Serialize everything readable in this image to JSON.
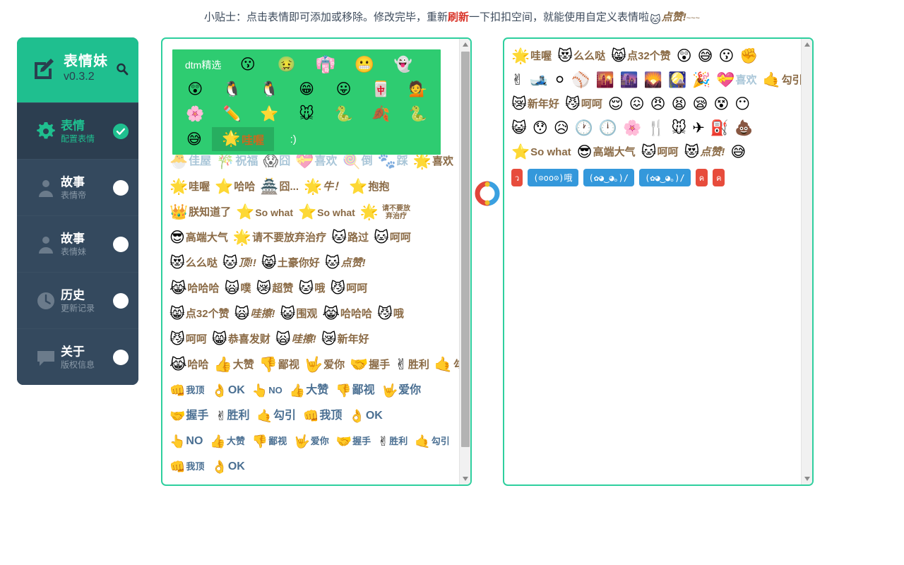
{
  "tip": {
    "before_hl": "小贴士：点击表情即可添加或移除。修改完毕，重新",
    "hl": "刷新",
    "after_hl": "一下扣扣空间，就能使用自定义表情啦",
    "emoji": "🐱",
    "zan": "点赞!",
    "tail": "~~~"
  },
  "sidebar": {
    "header": {
      "app_name": "表情妹",
      "version": "v0.3.2",
      "edit_icon": "edit-square-icon",
      "search_icon": "search-icon"
    },
    "items": [
      {
        "title": "表情",
        "subtitle": "配置表情",
        "icon": "gear-icon",
        "active": true,
        "toggle": "check-circle"
      },
      {
        "title": "故事",
        "subtitle": "表情帝",
        "icon": "user-icon",
        "active": false,
        "toggle": "dot"
      },
      {
        "title": "故事",
        "subtitle": "表情妹",
        "icon": "user-icon",
        "active": false,
        "toggle": "dot"
      },
      {
        "title": "历史",
        "subtitle": "更新记录",
        "icon": "clock-icon",
        "active": false,
        "toggle": "dot"
      },
      {
        "title": "关于",
        "subtitle": "版权信息",
        "icon": "comment-icon",
        "active": false,
        "toggle": "dot"
      }
    ]
  },
  "featured": {
    "label": "dtm精选",
    "row1": [
      "😗",
      "🤢",
      "👘",
      "😬",
      "👻"
    ],
    "row2": [
      "😲",
      "🐧",
      "🐧",
      "😁",
      "😛",
      "🀄",
      "💁"
    ],
    "row3": [
      "🌸",
      "✏️",
      "⭐",
      "🐭",
      "🐍",
      "🍂",
      "🐍"
    ],
    "smile": "😅",
    "chip": {
      "glyph": "🌟",
      "word": "哇喔"
    },
    "semicolon": ":)"
  },
  "left_panel": {
    "rows": [
      {
        "style": "pale",
        "items": [
          {
            "g": "🐣",
            "w": "佳屋"
          },
          {
            "g": "🎋",
            "w": "祝福"
          },
          {
            "g": "😱",
            "w": "囧"
          },
          {
            "g": "💝",
            "w": "喜欢"
          },
          {
            "g": "🍭",
            "w": "倒"
          },
          {
            "g": "🐾",
            "w": "踩"
          },
          {
            "g": "🌟",
            "w": "喜欢",
            "warm": true
          }
        ]
      },
      {
        "style": "warm",
        "items": [
          {
            "g": "🌟",
            "w": "哇喔"
          },
          {
            "g": "⭐",
            "w": "哈哈"
          },
          {
            "g": "🏯",
            "w": "囧..."
          },
          {
            "g": "🌟",
            "w": "牛！",
            "ital": true
          },
          {
            "g": "⭐",
            "w": "抱抱"
          }
        ]
      },
      {
        "style": "warm",
        "items": [
          {
            "g": "👑",
            "w": "朕知道了"
          },
          {
            "g": "⭐",
            "w": "So what",
            "sw": true
          },
          {
            "g": "⭐",
            "w": "So what",
            "sw": true
          },
          {
            "g": "🌟",
            "w": "请不要放弃治疗",
            "two": true
          }
        ]
      },
      {
        "style": "warm",
        "items": [
          {
            "g": "😎",
            "w": "高端大气"
          },
          {
            "g": "🌟",
            "w": "请不要放弃治疗"
          },
          {
            "g": "🐱",
            "w": "路过"
          },
          {
            "g": "🐱",
            "w": "呵呵"
          }
        ]
      },
      {
        "style": "warm",
        "items": [
          {
            "g": "😻",
            "w": "么么哒"
          },
          {
            "g": "🐱",
            "w": "顶!!",
            "ital": true
          },
          {
            "g": "😸",
            "w": "土豪你好"
          },
          {
            "g": "🐱",
            "w": "点赞!",
            "ital": true
          }
        ]
      },
      {
        "style": "warm",
        "items": [
          {
            "g": "😹",
            "w": "哈哈哈"
          },
          {
            "g": "🙀",
            "w": "噗"
          },
          {
            "g": "😿",
            "w": "超赞"
          },
          {
            "g": "🐱",
            "w": "哦"
          },
          {
            "g": "😼",
            "w": "呵呵"
          }
        ]
      },
      {
        "style": "warm",
        "items": [
          {
            "g": "😸",
            "w": "点32个赞"
          },
          {
            "g": "🙀",
            "w": "哇擦!",
            "ital": true
          },
          {
            "g": "😺",
            "w": "围观"
          },
          {
            "g": "😹",
            "w": "哈哈哈"
          },
          {
            "g": "😼",
            "w": "哦"
          }
        ]
      },
      {
        "style": "warm",
        "items": [
          {
            "g": "😼",
            "w": "呵呵"
          },
          {
            "g": "😸",
            "w": "恭喜发财"
          },
          {
            "g": "🙀",
            "w": "哇擦!",
            "ital": true
          },
          {
            "g": "😿",
            "w": "新年好"
          }
        ]
      },
      {
        "style": "mixed",
        "items": [
          {
            "g": "😹",
            "w": "哈哈",
            "warm": true
          },
          {
            "g": "👍",
            "w": "大赞"
          },
          {
            "g": "👎",
            "w": "鄙视"
          },
          {
            "g": "🤟",
            "w": "爱你"
          },
          {
            "g": "🤝",
            "w": "握手"
          },
          {
            "g": "✌",
            "w": "胜利"
          },
          {
            "g": "🤙",
            "w": "勾引"
          }
        ]
      },
      {
        "style": "hands",
        "items": [
          {
            "g": "👊",
            "w": "我顶"
          },
          {
            "g": "👌",
            "w": "OK",
            "big": true
          },
          {
            "g": "👆",
            "w": "NO"
          },
          {
            "g": "👍",
            "w": "大赞",
            "big": true
          },
          {
            "g": "👎",
            "w": "鄙视",
            "big": true
          },
          {
            "g": "🤟",
            "w": "爱你",
            "big": true
          }
        ]
      },
      {
        "style": "hands",
        "items": [
          {
            "g": "🤝",
            "w": "握手",
            "big": true
          },
          {
            "g": "✌",
            "w": "胜利",
            "big": true
          },
          {
            "g": "🤙",
            "w": "勾引",
            "big": true
          },
          {
            "g": "👊",
            "w": "我顶",
            "big": true
          },
          {
            "g": "👌",
            "w": "OK",
            "big": true
          }
        ]
      },
      {
        "style": "hands",
        "items": [
          {
            "g": "👆",
            "w": "NO",
            "big": true
          },
          {
            "g": "👍",
            "w": "大赞"
          },
          {
            "g": "👎",
            "w": "鄙视"
          },
          {
            "g": "🤟",
            "w": "爱你"
          },
          {
            "g": "🤝",
            "w": "握手"
          },
          {
            "g": "✌",
            "w": "胜利"
          },
          {
            "g": "🤙",
            "w": "勾引"
          }
        ]
      },
      {
        "style": "hands",
        "items": [
          {
            "g": "👊",
            "w": "我顶"
          },
          {
            "g": "👌",
            "w": "OK",
            "big": true
          }
        ]
      }
    ]
  },
  "right_panel": {
    "rows": [
      {
        "items": [
          {
            "g": "🌟",
            "w": "哇喔"
          },
          {
            "g": "😻",
            "w": "么么哒"
          },
          {
            "g": "😸",
            "w": "点32个赞"
          },
          {
            "g": "😲"
          },
          {
            "g": "😅"
          },
          {
            "g": "😗"
          },
          {
            "g": "✊"
          }
        ]
      },
      {
        "items": [
          {
            "g": "✌"
          },
          {
            "g": "🎿"
          },
          {
            "g": "⚪"
          },
          {
            "g": "⚾"
          },
          {
            "g": "🌇"
          },
          {
            "g": "🌆"
          },
          {
            "g": "🌄"
          },
          {
            "g": "🎑"
          },
          {
            "g": "🎉"
          },
          {
            "g": "💝",
            "w": "喜欢",
            "pale": true
          },
          {
            "g": "🤙",
            "w": "勾引",
            "hand": true
          }
        ]
      },
      {
        "items": [
          {
            "g": "😿",
            "w": "新年好"
          },
          {
            "g": "😼",
            "w": "呵呵"
          },
          {
            "g": "😌"
          },
          {
            "g": "😖"
          },
          {
            "g": "😠"
          },
          {
            "g": "😫"
          },
          {
            "g": "😪"
          },
          {
            "g": "😵"
          },
          {
            "g": "😶"
          }
        ]
      },
      {
        "items": [
          {
            "g": "😺"
          },
          {
            "g": "😯"
          },
          {
            "g": "😥"
          },
          {
            "g": "🕐"
          },
          {
            "g": "🕛"
          },
          {
            "g": "🌸"
          },
          {
            "g": "🍴"
          },
          {
            "g": "🐭"
          },
          {
            "g": "✈"
          },
          {
            "g": "⛽"
          },
          {
            "g": "💩"
          }
        ]
      },
      {
        "items": [
          {
            "g": "⭐",
            "w": "So what",
            "sw": true
          },
          {
            "g": "😎",
            "w": "高端大气"
          },
          {
            "g": "🐱",
            "w": "呵呵"
          },
          {
            "g": "😻",
            "w": "点赞!",
            "ital": true
          },
          {
            "g": "😅"
          }
        ]
      }
    ],
    "kaomoji": [
      {
        "text": "ว",
        "color": "red"
      },
      {
        "text": "(⊙oo⊙)哦",
        "color": "blue"
      },
      {
        "text": "(✿◕‿◕｡)/",
        "color": "blue"
      },
      {
        "text": "(✿◕‿◕｡)/",
        "color": "blue"
      },
      {
        "text": "ค",
        "color": "red"
      },
      {
        "text": "ค",
        "color": "red"
      }
    ]
  },
  "sync": {
    "icon": "sync-refresh-icon",
    "color_a": "#e0453a",
    "color_b": "#3aa0e0"
  },
  "colors": {
    "accent_teal": "#2ecf9e",
    "header_green": "#1fbf8f",
    "featured_green": "#2ecc71",
    "sidebar_dark": "#2c3e50",
    "sidebar_item": "#34495e",
    "warm_text": "#8a6a45",
    "highlight_red": "#d9362b"
  }
}
